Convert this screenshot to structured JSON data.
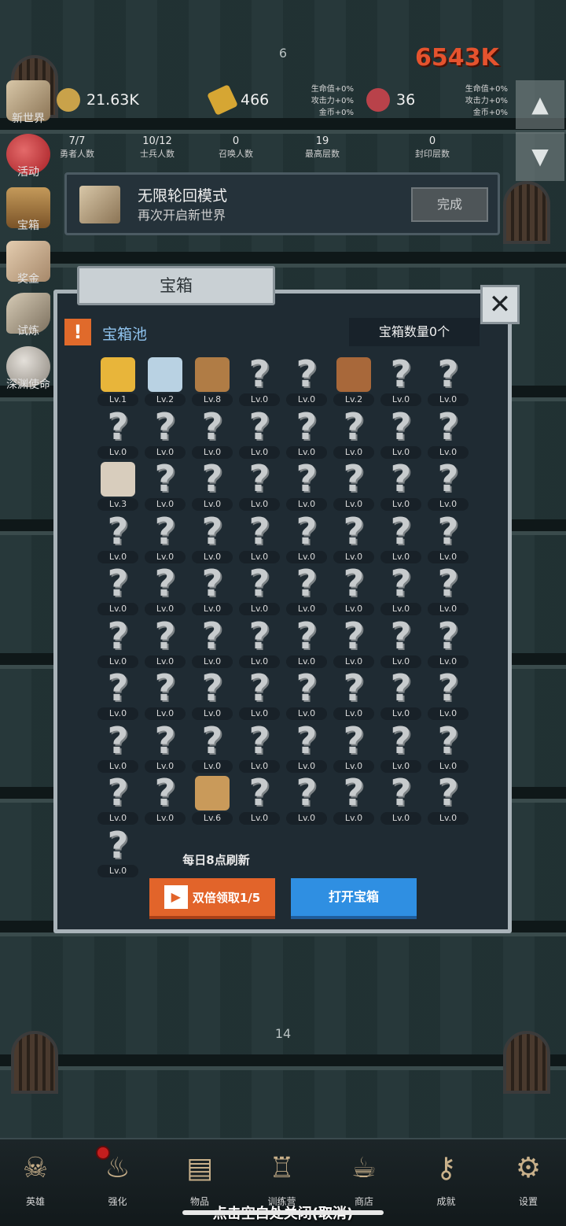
{
  "floors": {
    "top": "6",
    "bottom": "14"
  },
  "damage_text": "6543K",
  "resources": {
    "coin": "21.63K",
    "gold_bar": "466",
    "meat": "36"
  },
  "hero_stats": {
    "left": [
      "生命值+0%",
      "攻击力+0%",
      "金币+0%"
    ],
    "right": [
      "生命值+0%",
      "攻击力+0%",
      "金币+0%"
    ]
  },
  "counts": [
    {
      "value": "7/7",
      "label": "勇者人数"
    },
    {
      "value": "10/12",
      "label": "士兵人数"
    },
    {
      "value": "0",
      "label": "召唤人数"
    },
    {
      "value": "19",
      "label": "最高层数"
    },
    {
      "value": "0",
      "label": "封印层数"
    }
  ],
  "side_menu": [
    "新世界",
    "活动",
    "宝箱",
    "奖金",
    "试炼",
    "深渊使命"
  ],
  "quest": {
    "title": "无限轮回模式",
    "subtitle": "再次开启新世界",
    "button": "完成"
  },
  "dialog": {
    "title": "宝箱",
    "close": "✕",
    "pool_label": "宝箱池",
    "chest_count": "宝箱数量0个",
    "refresh_text": "每日8点刷新",
    "double_button": "双倍领取1/5",
    "open_button": "打开宝箱"
  },
  "items": [
    {
      "icon": "crown-icon",
      "color": "#e8b53a",
      "lv": "Lv.1"
    },
    {
      "icon": "diamond-icon",
      "color": "#b9d2e3",
      "lv": "Lv.2"
    },
    {
      "icon": "sword-icon",
      "color": "#b07c45",
      "lv": "Lv.8"
    },
    {
      "icon": "unknown",
      "lv": "Lv.0"
    },
    {
      "icon": "unknown",
      "lv": "Lv.0"
    },
    {
      "icon": "armor-icon",
      "color": "#a8683a",
      "lv": "Lv.2"
    },
    {
      "icon": "unknown",
      "lv": "Lv.0"
    },
    {
      "icon": "unknown",
      "lv": "Lv.0"
    },
    {
      "icon": "unknown",
      "lv": "Lv.0"
    },
    {
      "icon": "unknown",
      "lv": "Lv.0"
    },
    {
      "icon": "unknown",
      "lv": "Lv.0"
    },
    {
      "icon": "unknown",
      "lv": "Lv.0"
    },
    {
      "icon": "unknown",
      "lv": "Lv.0"
    },
    {
      "icon": "unknown",
      "lv": "Lv.0"
    },
    {
      "icon": "unknown",
      "lv": "Lv.0"
    },
    {
      "icon": "unknown",
      "lv": "Lv.0"
    },
    {
      "icon": "stone-icon",
      "color": "#d8cdbd",
      "lv": "Lv.3"
    },
    {
      "icon": "unknown",
      "lv": "Lv.0"
    },
    {
      "icon": "unknown",
      "lv": "Lv.0"
    },
    {
      "icon": "unknown",
      "lv": "Lv.0"
    },
    {
      "icon": "unknown",
      "lv": "Lv.0"
    },
    {
      "icon": "unknown",
      "lv": "Lv.0"
    },
    {
      "icon": "unknown",
      "lv": "Lv.0"
    },
    {
      "icon": "unknown",
      "lv": "Lv.0"
    },
    {
      "icon": "unknown",
      "lv": "Lv.0"
    },
    {
      "icon": "unknown",
      "lv": "Lv.0"
    },
    {
      "icon": "unknown",
      "lv": "Lv.0"
    },
    {
      "icon": "unknown",
      "lv": "Lv.0"
    },
    {
      "icon": "unknown",
      "lv": "Lv.0"
    },
    {
      "icon": "unknown",
      "lv": "Lv.0"
    },
    {
      "icon": "unknown",
      "lv": "Lv.0"
    },
    {
      "icon": "unknown",
      "lv": "Lv.0"
    },
    {
      "icon": "unknown",
      "lv": "Lv.0"
    },
    {
      "icon": "unknown",
      "lv": "Lv.0"
    },
    {
      "icon": "unknown",
      "lv": "Lv.0"
    },
    {
      "icon": "unknown",
      "lv": "Lv.0"
    },
    {
      "icon": "unknown",
      "lv": "Lv.0"
    },
    {
      "icon": "unknown",
      "lv": "Lv.0"
    },
    {
      "icon": "unknown",
      "lv": "Lv.0"
    },
    {
      "icon": "unknown",
      "lv": "Lv.0"
    },
    {
      "icon": "unknown",
      "lv": "Lv.0"
    },
    {
      "icon": "unknown",
      "lv": "Lv.0"
    },
    {
      "icon": "unknown",
      "lv": "Lv.0"
    },
    {
      "icon": "unknown",
      "lv": "Lv.0"
    },
    {
      "icon": "unknown",
      "lv": "Lv.0"
    },
    {
      "icon": "unknown",
      "lv": "Lv.0"
    },
    {
      "icon": "unknown",
      "lv": "Lv.0"
    },
    {
      "icon": "unknown",
      "lv": "Lv.0"
    },
    {
      "icon": "unknown",
      "lv": "Lv.0"
    },
    {
      "icon": "unknown",
      "lv": "Lv.0"
    },
    {
      "icon": "unknown",
      "lv": "Lv.0"
    },
    {
      "icon": "unknown",
      "lv": "Lv.0"
    },
    {
      "icon": "unknown",
      "lv": "Lv.0"
    },
    {
      "icon": "unknown",
      "lv": "Lv.0"
    },
    {
      "icon": "unknown",
      "lv": "Lv.0"
    },
    {
      "icon": "unknown",
      "lv": "Lv.0"
    },
    {
      "icon": "unknown",
      "lv": "Lv.0"
    },
    {
      "icon": "unknown",
      "lv": "Lv.0"
    },
    {
      "icon": "unknown",
      "lv": "Lv.0"
    },
    {
      "icon": "unknown",
      "lv": "Lv.0"
    },
    {
      "icon": "unknown",
      "lv": "Lv.0"
    },
    {
      "icon": "unknown",
      "lv": "Lv.0"
    },
    {
      "icon": "unknown",
      "lv": "Lv.0"
    },
    {
      "icon": "unknown",
      "lv": "Lv.0"
    },
    {
      "icon": "unknown",
      "lv": "Lv.0"
    },
    {
      "icon": "unknown",
      "lv": "Lv.0"
    },
    {
      "icon": "beer-mug-icon",
      "color": "#c99a5a",
      "lv": "Lv.6"
    },
    {
      "icon": "unknown",
      "lv": "Lv.0"
    },
    {
      "icon": "unknown",
      "lv": "Lv.0"
    },
    {
      "icon": "unknown",
      "lv": "Lv.0"
    },
    {
      "icon": "unknown",
      "lv": "Lv.0"
    },
    {
      "icon": "unknown",
      "lv": "Lv.0"
    },
    {
      "icon": "unknown",
      "lv": "Lv.0"
    }
  ],
  "bottom_nav": [
    {
      "label": "英雄",
      "icon": "skull-icon"
    },
    {
      "label": "强化",
      "icon": "candle-icon"
    },
    {
      "label": "物品",
      "icon": "book-icon"
    },
    {
      "label": "训练营",
      "icon": "lantern-icon"
    },
    {
      "label": "商店",
      "icon": "beer-mug-icon"
    },
    {
      "label": "成就",
      "icon": "key-icon"
    },
    {
      "label": "设置",
      "icon": "gear-icon"
    }
  ],
  "close_hint": "点击空白处关闭(取消)"
}
